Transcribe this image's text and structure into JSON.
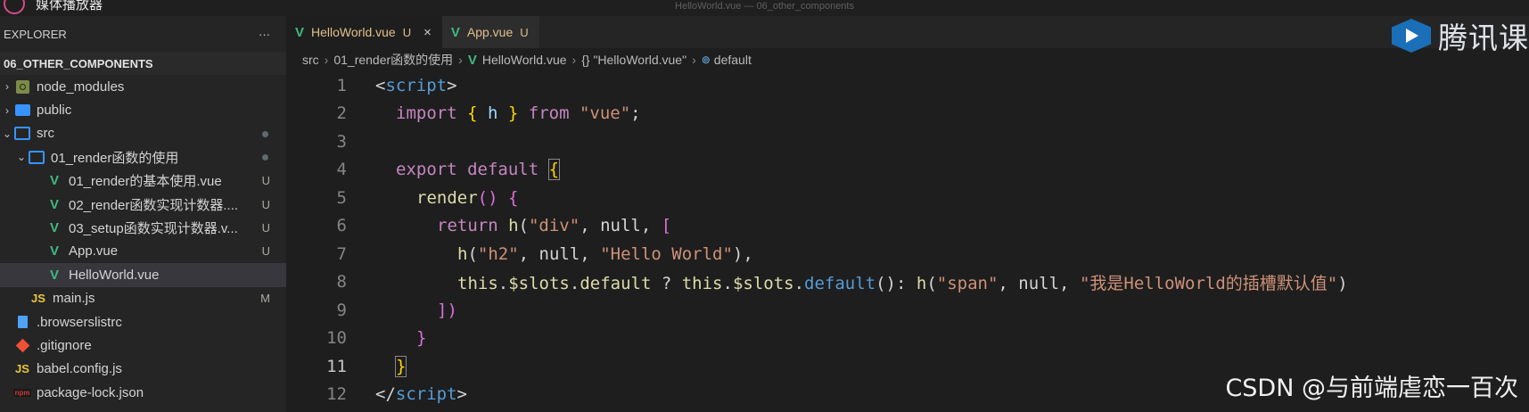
{
  "app": {
    "label": "媒体播放器",
    "window_title": "HelloWorld.vue — 06_other_components"
  },
  "sidebar": {
    "title": "EXPLORER",
    "more": "···",
    "project": "06_OTHER_COMPONENTS",
    "items": [
      {
        "label": "node_modules",
        "badge": ""
      },
      {
        "label": "public",
        "badge": ""
      },
      {
        "label": "src",
        "badge": ""
      },
      {
        "label": "01_render函数的使用",
        "badge": ""
      },
      {
        "label": "01_render的基本使用.vue",
        "badge": "U"
      },
      {
        "label": "02_render函数实现计数器....",
        "badge": "U"
      },
      {
        "label": "03_setup函数实现计数器.v...",
        "badge": "U"
      },
      {
        "label": "App.vue",
        "badge": "U"
      },
      {
        "label": "HelloWorld.vue",
        "badge": ""
      },
      {
        "label": "main.js",
        "badge": "M"
      },
      {
        "label": ".browserslistrc",
        "badge": ""
      },
      {
        "label": ".gitignore",
        "badge": ""
      },
      {
        "label": "babel.config.js",
        "badge": ""
      },
      {
        "label": "package-lock.json",
        "badge": ""
      }
    ]
  },
  "tabs": [
    {
      "label": "HelloWorld.vue",
      "status": "U",
      "close": "×"
    },
    {
      "label": "App.vue",
      "status": "U"
    }
  ],
  "breadcrumb": {
    "src": "src",
    "folder": "01_render函数的使用",
    "file": "HelloWorld.vue",
    "object": "{} \"HelloWorld.vue\"",
    "symbol": "default"
  },
  "watermark": {
    "text": "腾讯课"
  },
  "csdn": "CSDN @与前端虐恋一百次",
  "editor": {
    "line_numbers": [
      "1",
      "2",
      "3",
      "4",
      "5",
      "6",
      "7",
      "8",
      "9",
      "10",
      "11",
      "12"
    ],
    "current_line": "11",
    "tokens": {
      "l1_open": "<",
      "l1_tag": "script",
      "l1_close": ">",
      "l2_import": "import",
      "l2_ob": "{",
      "l2_h": " h ",
      "l2_cb": "}",
      "l2_from": " from ",
      "l2_str": "\"vue\"",
      "l2_semi": ";",
      "l4_export": "export",
      "l4_default": " default ",
      "l4_ob": "{",
      "l5_render": "render",
      "l5_parens": "()",
      "l5_ob": " {",
      "l6_return": "return",
      "l6_h": " h",
      "l6_paren": "(",
      "l6_div": "\"div\"",
      "l6_null": ", null, ",
      "l6_bracket": "[",
      "l7_h": "h",
      "l7_paren": "(",
      "l7_h2": "\"h2\"",
      "l7_null": ", null, ",
      "l7_str": "\"Hello World\"",
      "l7_end": "),",
      "l8_this": "this",
      "l8_dot1": ".",
      "l8_slots": "$slots",
      "l8_dot2": ".",
      "l8_default": "default",
      "l8_q": " ? ",
      "l8_this2": "this",
      "l8_dot3": ".",
      "l8_slots2": "$slots",
      "l8_dot4": ".",
      "l8_defaultfn": "default",
      "l8_call": "(): ",
      "l8_h": "h",
      "l8_paren": "(",
      "l8_span": "\"span\"",
      "l8_null": ", null, ",
      "l8_str": "\"我是HelloWorld的插槽默认值\"",
      "l8_end": ")",
      "l9_end": "])",
      "l10_cb": "}",
      "l11_cb": "}",
      "l12_open": "</",
      "l12_tag": "script",
      "l12_close": ">"
    }
  },
  "colors": {
    "vue": "#41b883",
    "folder": "#3794ff",
    "modified_tab": "#e2c08d"
  }
}
